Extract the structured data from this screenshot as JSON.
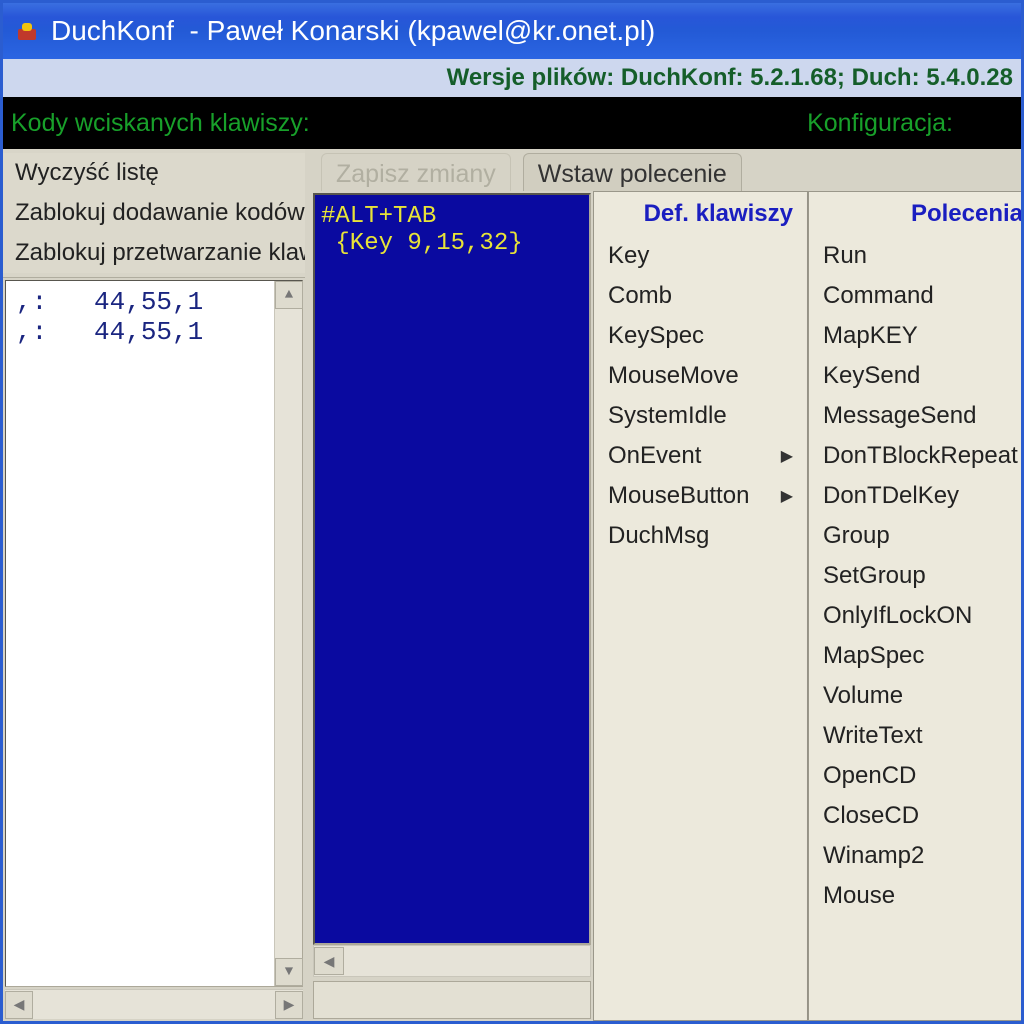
{
  "titlebar": {
    "app_name": "DuchKonf",
    "author": "Paweł Konarski (kpawel@kr.onet.pl)"
  },
  "versionbar": "Wersje plików: DuchKonf: 5.2.1.68; Duch: 5.4.0.28",
  "header": {
    "left": "Kody wciskanych klawiszy:",
    "right": "Konfiguracja:"
  },
  "left_panel": {
    "buttons": [
      "Wyczyść listę",
      "Zablokuj dodawanie kodów",
      "Zablokuj przetwarzanie klawiszy"
    ],
    "rows": [
      ",:   44,55,1",
      ",:   44,55,1"
    ]
  },
  "tabs": [
    {
      "label": "Zapisz zmiany",
      "active": false
    },
    {
      "label": "Wstaw polecenie",
      "active": true
    }
  ],
  "editor_lines": [
    "#ALT+TAB",
    " {Key 9,15,32}"
  ],
  "popup_left": {
    "title": "Def. klawiszy",
    "items": [
      {
        "label": "Key",
        "submenu": false
      },
      {
        "label": "Comb",
        "submenu": false
      },
      {
        "label": "KeySpec",
        "submenu": false
      },
      {
        "label": "MouseMove",
        "submenu": false
      },
      {
        "label": "SystemIdle",
        "submenu": false
      },
      {
        "label": "OnEvent",
        "submenu": true
      },
      {
        "label": "MouseButton",
        "submenu": true
      },
      {
        "label": "DuchMsg",
        "submenu": false
      }
    ]
  },
  "popup_right": {
    "title": "Polecenia",
    "items": [
      "Run",
      "Command",
      "MapKEY",
      "KeySend",
      "MessageSend",
      "DonTBlockRepeat",
      "DonTDelKey",
      "Group",
      "SetGroup",
      "OnlyIfLockON",
      "MapSpec",
      "Volume",
      "WriteText",
      "OpenCD",
      "CloseCD",
      "Winamp2",
      "Mouse"
    ]
  }
}
